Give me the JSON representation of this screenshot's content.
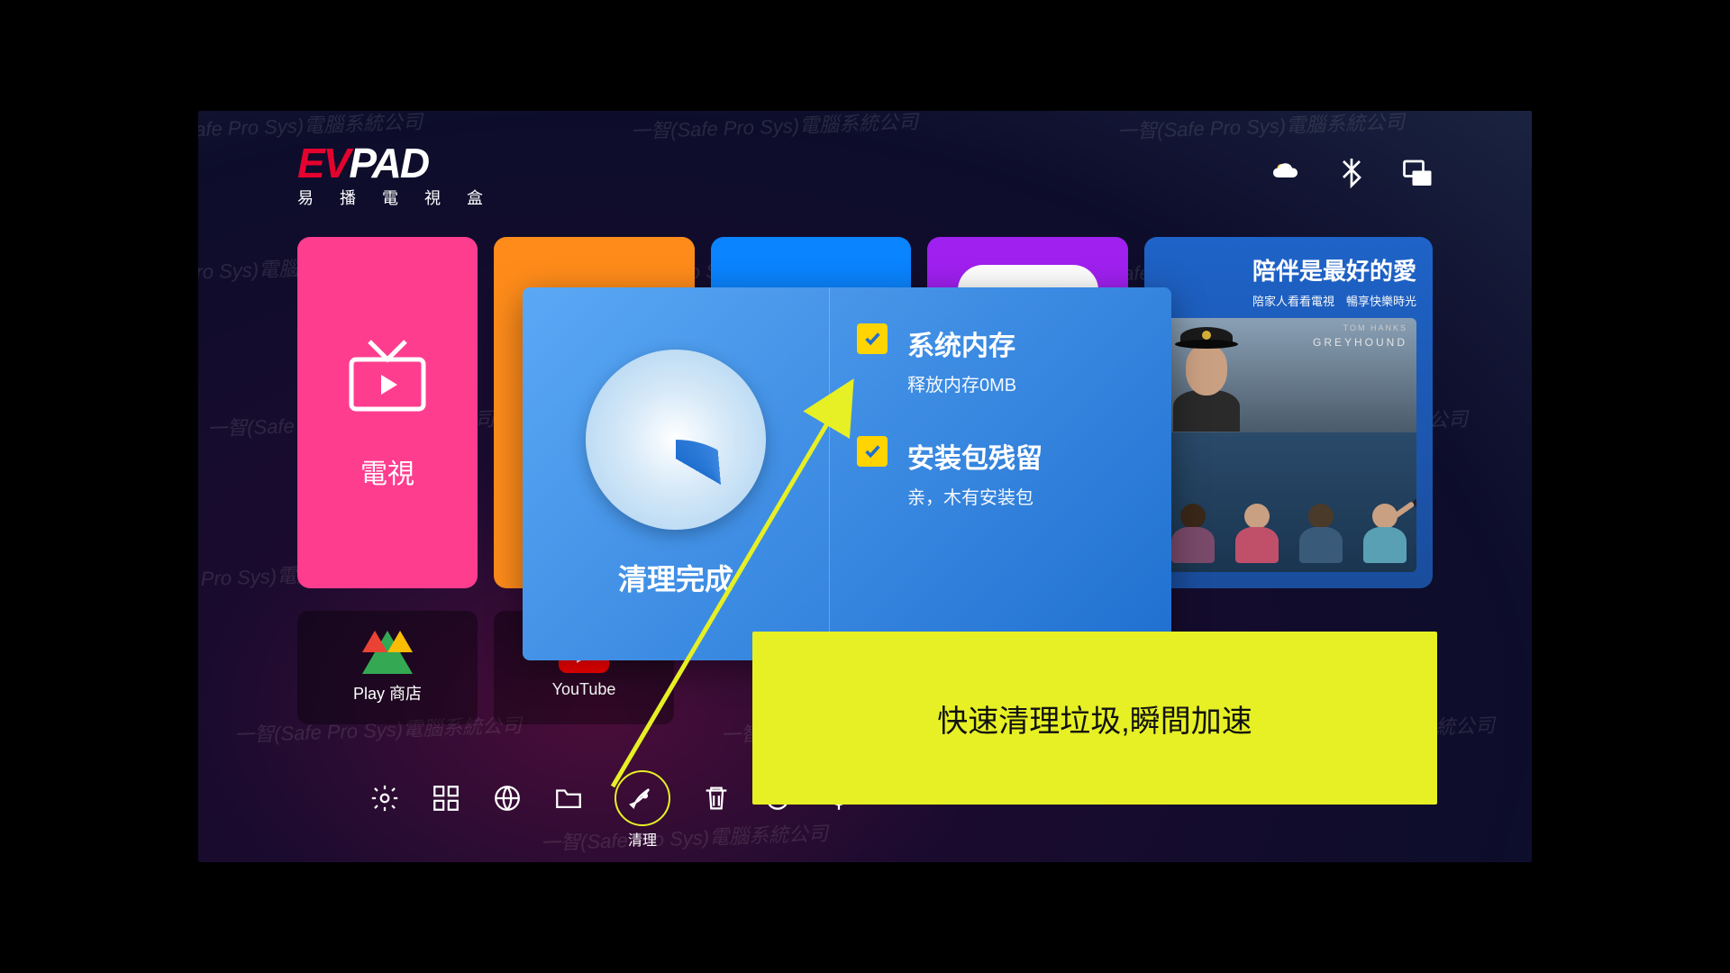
{
  "brand": {
    "logo_ev": "EV",
    "logo_pad": "PAD",
    "tagline": "易 播 電 視 盒"
  },
  "watermark": "一智(Safe Pro Sys)電腦系統公司",
  "tiles": {
    "tv_label": "電視"
  },
  "promo": {
    "title": "陪伴是最好的愛",
    "subtitle": "陪家人看看電視　暢享快樂時光",
    "movie_actor": "TOM HANKS",
    "movie_title": "GREYHOUND"
  },
  "apps": {
    "play": "Play 商店",
    "youtube": "YouTube"
  },
  "toolbar": {
    "clean_label": "清理"
  },
  "modal": {
    "status": "清理完成",
    "mem_title": "系统内存",
    "mem_detail": "释放内存0MB",
    "pkg_title": "安装包残留",
    "pkg_detail": "亲，木有安装包"
  },
  "tip": "快速清理垃圾,瞬間加速"
}
